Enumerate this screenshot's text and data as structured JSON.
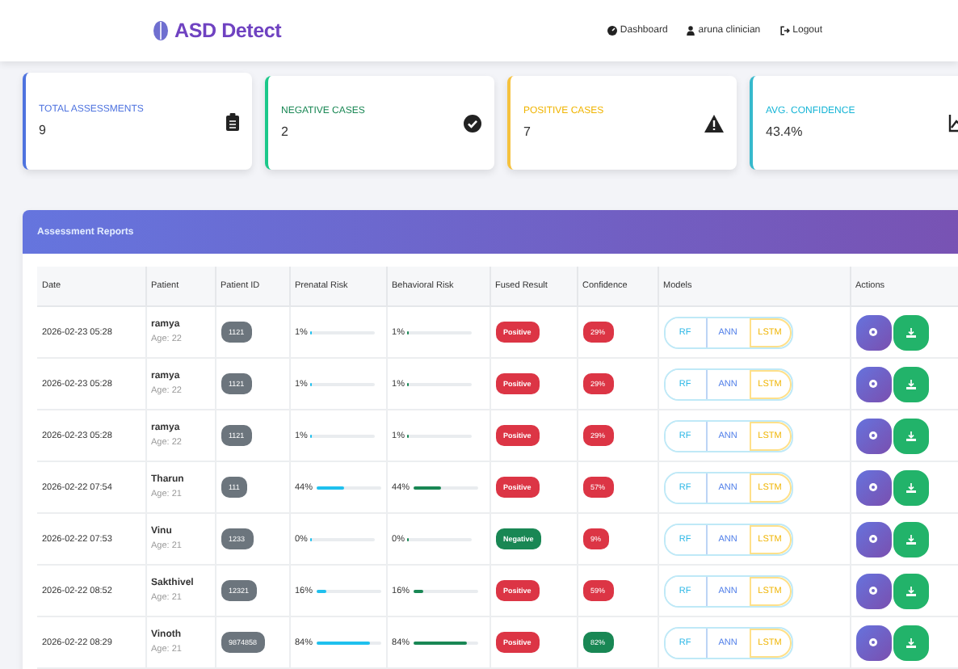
{
  "navbar": {
    "brand": "ASD Detect",
    "links": [
      {
        "kind": "dashboard",
        "label": "Dashboard"
      },
      {
        "kind": "user",
        "label": "aruna clinician"
      },
      {
        "kind": "logout",
        "label": "Logout"
      }
    ]
  },
  "stats": [
    {
      "kind": "total",
      "label": "TOTAL ASSESSMENTS",
      "value": "9"
    },
    {
      "kind": "negative",
      "label": "NEGATIVE CASES",
      "value": "2"
    },
    {
      "kind": "positive",
      "label": "POSITIVE CASES",
      "value": "7"
    },
    {
      "kind": "confidence",
      "label": "AVG. CONFIDENCE",
      "value": "43.4%"
    }
  ],
  "reports": {
    "title": "Assessment Reports",
    "columns": [
      "Date",
      "Patient",
      "Patient ID",
      "Prenatal Risk",
      "Behavioral Risk",
      "Fused Result",
      "Confidence",
      "Models",
      "Actions"
    ],
    "rows": [
      {
        "date": "2026-02-23 05:28",
        "patient": "ramya",
        "age": "Age: 22",
        "patient_id": "1121",
        "prenatal": {
          "reading": "1%",
          "level": 0.01
        },
        "behavioral": {
          "reading": "1%",
          "level": 0.01
        },
        "result": "Positive",
        "positive": true,
        "confidence": "29%",
        "high_confidence": false,
        "models": [
          "RF",
          "ANN",
          "LSTM"
        ]
      },
      {
        "date": "2026-02-23 05:28",
        "patient": "ramya",
        "age": "Age: 22",
        "patient_id": "1121",
        "prenatal": {
          "reading": "1%",
          "level": 0.01
        },
        "behavioral": {
          "reading": "1%",
          "level": 0.01
        },
        "result": "Positive",
        "positive": true,
        "confidence": "29%",
        "high_confidence": false,
        "models": [
          "RF",
          "ANN",
          "LSTM"
        ]
      },
      {
        "date": "2026-02-23 05:28",
        "patient": "ramya",
        "age": "Age: 22",
        "patient_id": "1121",
        "prenatal": {
          "reading": "1%",
          "level": 0.01
        },
        "behavioral": {
          "reading": "1%",
          "level": 0.01
        },
        "result": "Positive",
        "positive": true,
        "confidence": "29%",
        "high_confidence": false,
        "models": [
          "RF",
          "ANN",
          "LSTM"
        ]
      },
      {
        "date": "2026-02-22 07:54",
        "patient": "Tharun",
        "age": "Age: 21",
        "patient_id": "111",
        "prenatal": {
          "reading": "44%",
          "level": 0.44
        },
        "behavioral": {
          "reading": "44%",
          "level": 0.44
        },
        "result": "Positive",
        "positive": true,
        "confidence": "57%",
        "high_confidence": false,
        "models": [
          "RF",
          "ANN",
          "LSTM"
        ]
      },
      {
        "date": "2026-02-22 07:53",
        "patient": "Vinu",
        "age": "Age: 21",
        "patient_id": "1233",
        "prenatal": {
          "reading": "0%",
          "level": 0
        },
        "behavioral": {
          "reading": "0%",
          "level": 0
        },
        "result": "Negative",
        "positive": false,
        "confidence": "9%",
        "high_confidence": false,
        "models": [
          "RF",
          "ANN",
          "LSTM"
        ]
      },
      {
        "date": "2026-02-22 08:52",
        "patient": "Sakthivel",
        "age": "Age: 21",
        "patient_id": "12321",
        "prenatal": {
          "reading": "16%",
          "level": 0.16
        },
        "behavioral": {
          "reading": "16%",
          "level": 0.16
        },
        "result": "Positive",
        "positive": true,
        "confidence": "59%",
        "high_confidence": false,
        "models": [
          "RF",
          "ANN",
          "LSTM"
        ]
      },
      {
        "date": "2026-02-22 08:29",
        "patient": "Vinoth",
        "age": "Age: 21",
        "patient_id": "9874858",
        "prenatal": {
          "reading": "84%",
          "level": 0.84
        },
        "behavioral": {
          "reading": "84%",
          "level": 0.84
        },
        "result": "Positive",
        "positive": true,
        "confidence": "82%",
        "high_confidence": true,
        "models": [
          "RF",
          "ANN",
          "LSTM"
        ]
      }
    ]
  }
}
